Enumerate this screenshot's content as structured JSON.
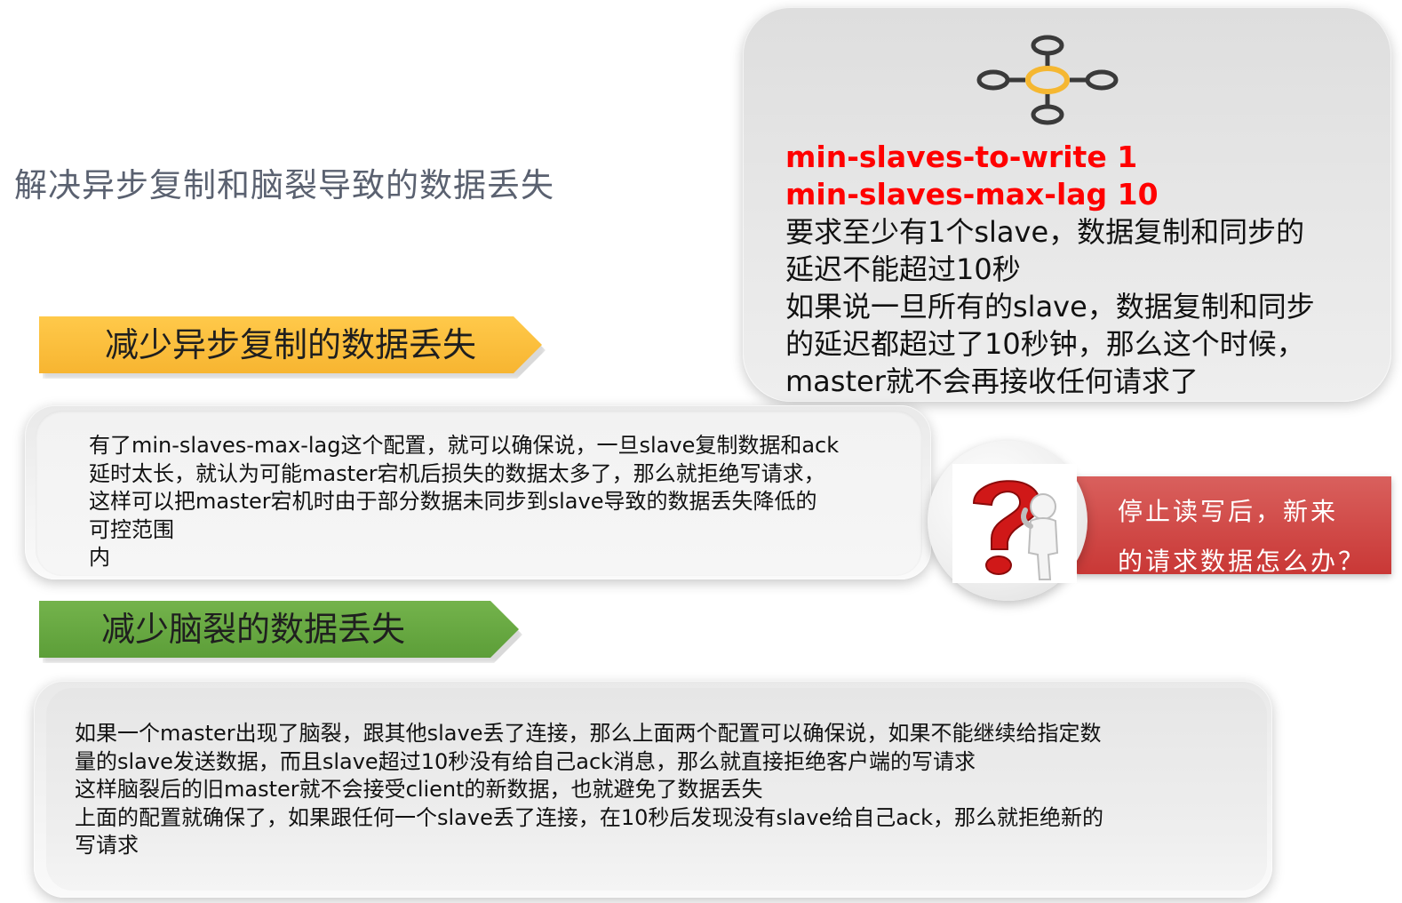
{
  "page_title": "解决异步复制和脑裂导致的数据丢失",
  "top_panel": {
    "config_lines": [
      "min-slaves-to-write 1",
      "min-slaves-max-lag 10"
    ],
    "description_lines": [
      "要求至少有1个slave，数据复制和同步的",
      "延迟不能超过10秒",
      "如果说一旦所有的slave，数据复制和同步",
      "的延迟都超过了10秒钟，那么这个时候，",
      "master就不会再接收任何请求了"
    ],
    "icon": "network-nodes-icon"
  },
  "section_async": {
    "label": "减少异步复制的数据丢失",
    "color": "#f7b531",
    "text_lines": [
      "有了min-slaves-max-lag这个配置，就可以确保说，一旦slave复制数据和ack",
      "延时太长，就认为可能master宕机后损失的数据太多了，那么就拒绝写请求，",
      "这样可以把master宕机时由于部分数据未同步到slave导致的数据丢失降低的",
      "可控范围",
      "内"
    ]
  },
  "question": {
    "icon": "question-mark-figure-icon",
    "banner_lines": [
      "停止读写后，新来",
      "的请求数据怎么办？"
    ],
    "banner_color": "#c93836"
  },
  "section_split_brain": {
    "label": "减少脑裂的数据丢失",
    "color": "#5c9e38",
    "text_lines": [
      "如果一个master出现了脑裂，跟其他slave丢了连接，那么上面两个配置可以确保说，如果不能继续给指定数",
      "量的slave发送数据，而且slave超过10秒没有给自己ack消息，那么就直接拒绝客户端的写请求",
      "这样脑裂后的旧master就不会接受client的新数据，也就避免了数据丢失",
      "上面的配置就确保了，如果跟任何一个slave丢了连接，在10秒后发现没有slave给自己ack，那么就拒绝新的",
      "写请求"
    ]
  }
}
